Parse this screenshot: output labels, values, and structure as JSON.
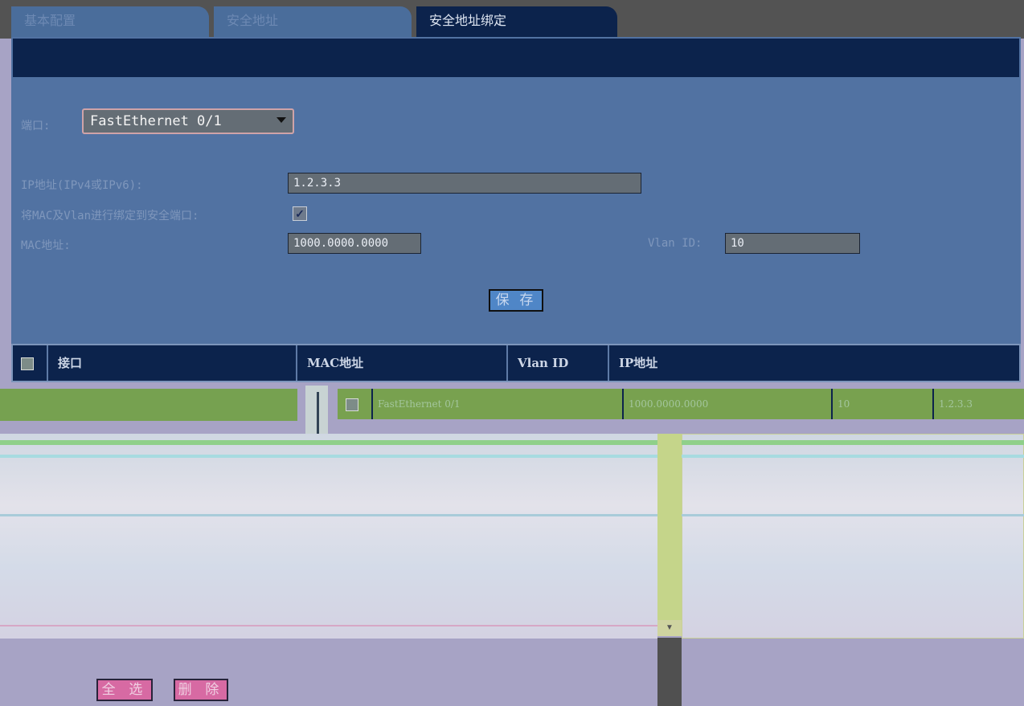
{
  "tabs": [
    {
      "label": "基本配置"
    },
    {
      "label": "安全地址"
    },
    {
      "label": "安全地址绑定"
    }
  ],
  "form": {
    "port_label": "端口:",
    "port_value": "FastEthernet 0/1",
    "ip_label": "IP地址(IPv4或IPv6):",
    "ip_value": "1.2.3.3",
    "bind_label": "将MAC及Vlan进行绑定到安全端口:",
    "bind_checked": true,
    "mac_label": "MAC地址:",
    "mac_value": "1000.0000.0000",
    "vlan_label": "Vlan ID:",
    "vlan_value": "10",
    "save_label": "保 存"
  },
  "table": {
    "headers": [
      "接口",
      "MAC地址",
      "Vlan ID",
      "IP地址"
    ],
    "rows": [
      {
        "interface": "FastEthernet 0/1",
        "mac": "1000.0000.0000",
        "vlan": "10",
        "ip": "1.2.3.3"
      }
    ]
  },
  "actions": {
    "select_all": "全 选",
    "delete": "删 除"
  }
}
